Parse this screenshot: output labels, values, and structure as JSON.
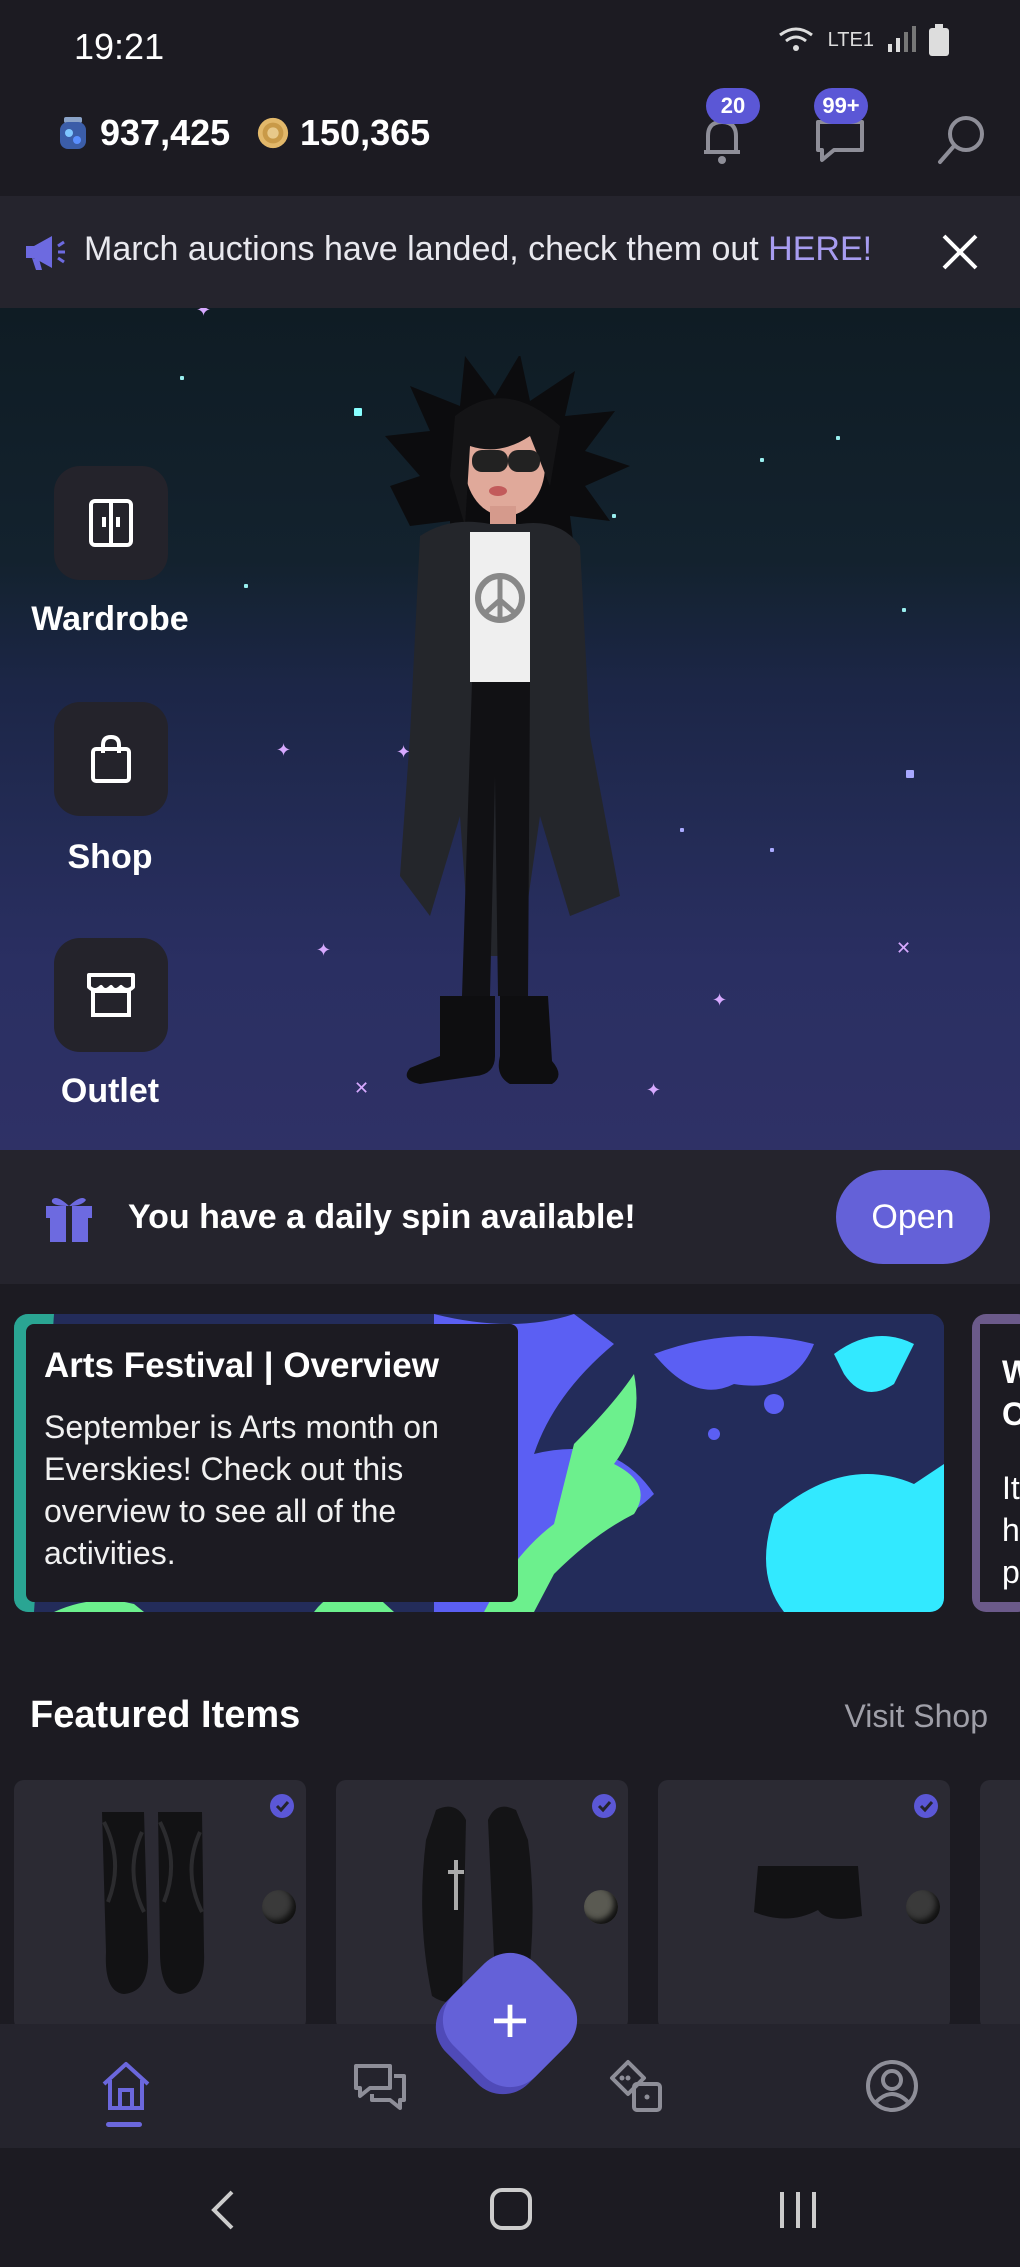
{
  "status_bar": {
    "time": "19:21",
    "indicators": "LTE1"
  },
  "header": {
    "gems": "937,425",
    "coins": "150,365",
    "notifications_badge": "20",
    "messages_badge": "99+"
  },
  "announcement": {
    "text": "March auctions have landed, check them out ",
    "link": "HERE!"
  },
  "side_menu": [
    {
      "label": "Wardrobe",
      "icon": "wardrobe-icon"
    },
    {
      "label": "Shop",
      "icon": "shopping-bag-icon"
    },
    {
      "label": "Outlet",
      "icon": "store-icon"
    }
  ],
  "daily_spin": {
    "text": "You have a daily spin available!",
    "button": "Open"
  },
  "news_cards": [
    {
      "title": "Arts Festival | Overview",
      "body": "September is Arts month on Everskies! Check out this overview to see all of the activities."
    },
    {
      "title": "W",
      "subtitle": "C",
      "body_lines": [
        "It",
        "h",
        "p"
      ]
    }
  ],
  "featured": {
    "title": "Featured Items",
    "link": "Visit Shop",
    "items": [
      {
        "name": "black-fur-boots",
        "color_dot": "#3a3a3a"
      },
      {
        "name": "black-leather-jacket",
        "color_dot": "#5a5a5a"
      },
      {
        "name": "black-mini-skirt",
        "color_dot": "#3a3a3a"
      }
    ]
  },
  "bottom_nav": [
    {
      "name": "home",
      "active": true
    },
    {
      "name": "chat",
      "active": false
    },
    {
      "name": "games",
      "active": false
    },
    {
      "name": "profile",
      "active": false
    }
  ],
  "colors": {
    "accent": "#6461d8",
    "background": "#1c1b22",
    "surface": "#25242d",
    "link": "#a79cf0"
  }
}
